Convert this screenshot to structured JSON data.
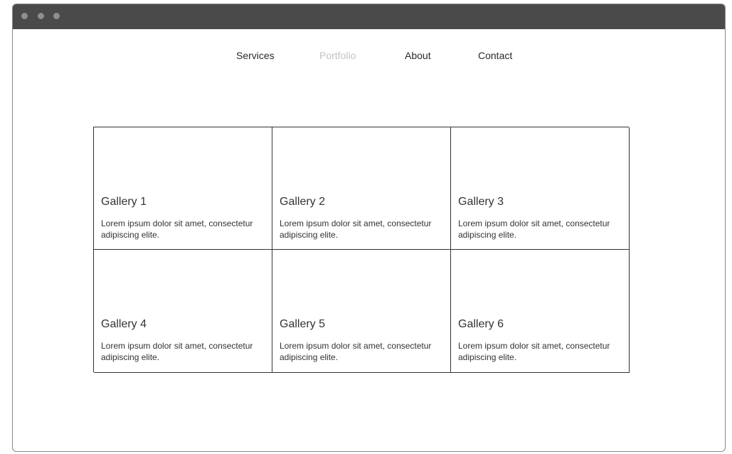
{
  "nav": {
    "items": [
      {
        "label": "Services",
        "active": false
      },
      {
        "label": "Portfolio",
        "active": true
      },
      {
        "label": "About",
        "active": false
      },
      {
        "label": "Contact",
        "active": false
      }
    ]
  },
  "gallery": {
    "items": [
      {
        "title": "Gallery 1",
        "description": "Lorem ipsum dolor sit amet, consectetur adipiscing elite."
      },
      {
        "title": "Gallery 2",
        "description": "Lorem ipsum dolor sit amet, consectetur adipiscing elite."
      },
      {
        "title": "Gallery 3",
        "description": "Lorem ipsum dolor sit amet, consectetur adipiscing elite."
      },
      {
        "title": "Gallery 4",
        "description": "Lorem ipsum dolor sit amet, consectetur adipiscing elite."
      },
      {
        "title": "Gallery 5",
        "description": "Lorem ipsum dolor sit amet, consectetur adipiscing elite."
      },
      {
        "title": "Gallery 6",
        "description": "Lorem ipsum dolor sit amet, consectetur adipiscing elite."
      }
    ]
  },
  "colors": {
    "titlebar": "#4a4a4a",
    "nav_text": "#2a2a2a",
    "nav_active": "#c2c2c2",
    "border": "#333333"
  }
}
